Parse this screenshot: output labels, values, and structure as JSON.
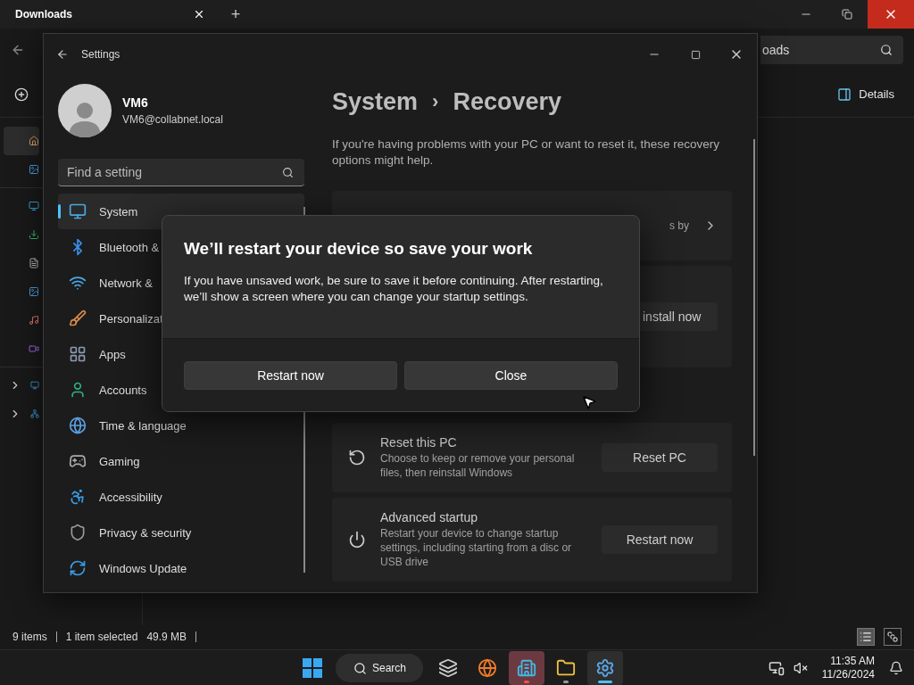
{
  "explorer": {
    "tab": "Downloads",
    "new_tab": "+",
    "address": "oads",
    "details": "Details",
    "nav_groups": [
      [
        {
          "kind": "home",
          "selected": true,
          "expandable": false
        },
        {
          "kind": "gallery",
          "selected": false,
          "expandable": false
        }
      ],
      [
        {
          "kind": "desktop",
          "selected": false,
          "expandable": false
        },
        {
          "kind": "downloads",
          "selected": false,
          "expandable": false
        },
        {
          "kind": "documents",
          "selected": false,
          "expandable": false
        },
        {
          "kind": "pictures",
          "selected": false,
          "expandable": false
        },
        {
          "kind": "music",
          "selected": false,
          "expandable": false
        },
        {
          "kind": "videos",
          "selected": false,
          "expandable": false
        }
      ],
      [
        {
          "kind": "pc",
          "selected": false,
          "expandable": true
        },
        {
          "kind": "network",
          "selected": false,
          "expandable": true
        }
      ]
    ],
    "status": {
      "count": "9 items",
      "selection": "1 item selected",
      "size": "49.9 MB"
    }
  },
  "settings": {
    "title": "Settings",
    "user": {
      "name": "VM6",
      "email": "VM6@collabnet.local"
    },
    "search": {
      "placeholder": "Find a setting"
    },
    "nav": [
      {
        "kind": "system",
        "label": "System",
        "selected": true
      },
      {
        "kind": "bluetooth",
        "label": "Bluetooth &",
        "selected": false
      },
      {
        "kind": "network",
        "label": "Network &",
        "selected": false
      },
      {
        "kind": "brush",
        "label": "Personalizat",
        "selected": false
      },
      {
        "kind": "apps",
        "label": "Apps",
        "selected": false
      },
      {
        "kind": "accounts",
        "label": "Accounts",
        "selected": false
      },
      {
        "kind": "time",
        "label": "Time & language",
        "selected": false
      },
      {
        "kind": "gaming",
        "label": "Gaming",
        "selected": false
      },
      {
        "kind": "accessibility",
        "label": "Accessibility",
        "selected": false
      },
      {
        "kind": "privacy",
        "label": "Privacy & security",
        "selected": false
      },
      {
        "kind": "update",
        "label": "Windows Update",
        "selected": false
      }
    ],
    "breadcrumb": {
      "parent": "System",
      "separator": "›",
      "current": "Recovery"
    },
    "intro": "If you're having problems with your PC or want to reset it, these recovery options might help.",
    "cards": [
      {
        "kind": "link",
        "fragment": "s by"
      },
      {
        "kind": "action",
        "button": "install now"
      },
      {
        "kind": "option",
        "title": "Reset this PC",
        "description": "Choose to keep or remove your personal files, then reinstall Windows",
        "button": "Reset PC"
      },
      {
        "kind": "option",
        "title": "Advanced startup",
        "description": "Restart your device to change startup settings, including starting from a disc or USB drive",
        "button": "Restart now"
      }
    ]
  },
  "dialog": {
    "title": "We’ll restart your device so save your work",
    "body": "If you have unsaved work, be sure to save it before continuing. After restarting, we’ll show a screen where you can change your startup settings.",
    "buttons": [
      "Restart now",
      "Close"
    ]
  },
  "taskbar": {
    "search": "Search",
    "apps": [
      {
        "kind": "taskview",
        "running": false,
        "active": false,
        "flashing": false
      },
      {
        "kind": "browser",
        "running": false,
        "active": false,
        "flashing": false
      },
      {
        "kind": "building",
        "running": true,
        "active": false,
        "flashing": true
      },
      {
        "kind": "files",
        "running": true,
        "active": false,
        "flashing": false
      },
      {
        "kind": "settings",
        "running": true,
        "active": true,
        "flashing": false
      }
    ],
    "time": "11:35 AM",
    "date": "11/26/2024"
  }
}
